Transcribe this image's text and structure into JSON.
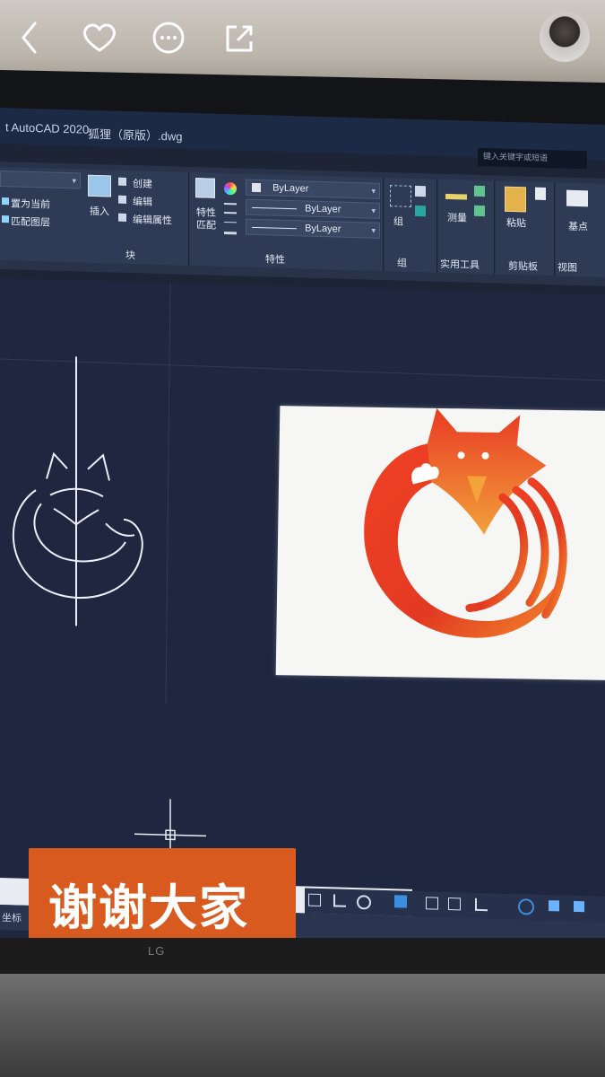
{
  "topbar": {
    "icons": [
      "chevron-left-icon",
      "heart-icon",
      "more-icon",
      "share-icon"
    ],
    "avatar": "avatar"
  },
  "autocad": {
    "app_title": "t AutoCAD 2020",
    "file_title": "狐狸（原版）.dwg",
    "search_placeholder": "键入关键字或短语",
    "ribbon": {
      "layer_panel": {
        "set_current": "置为当前",
        "match_layer": "匹配图层"
      },
      "block_panel": {
        "insert": "插入",
        "create": "创建",
        "edit": "编辑",
        "edit_attributes": "编辑属性",
        "label": "块"
      },
      "properties_panel": {
        "match": "特性",
        "match2": "匹配",
        "color": "ByLayer",
        "linetype": "ByLayer",
        "lineweight": "ByLayer",
        "label": "特性"
      },
      "groups_panel": {
        "group": "组",
        "label": "组"
      },
      "utilities_panel": {
        "measure": "测量",
        "label": "实用工具"
      },
      "clipboard_panel": {
        "paste": "粘贴",
        "label": "剪贴板"
      },
      "view_panel": {
        "base": "基点",
        "label": "视图"
      }
    },
    "status_left": "坐标"
  },
  "caption": {
    "text": "谢谢大家"
  },
  "monitor_brand": "LG",
  "colors": {
    "caption_bg": "#d85a1f",
    "logo_red": "#e23a22",
    "logo_orange": "#f28a2a",
    "cad_bg": "#1f2740"
  }
}
